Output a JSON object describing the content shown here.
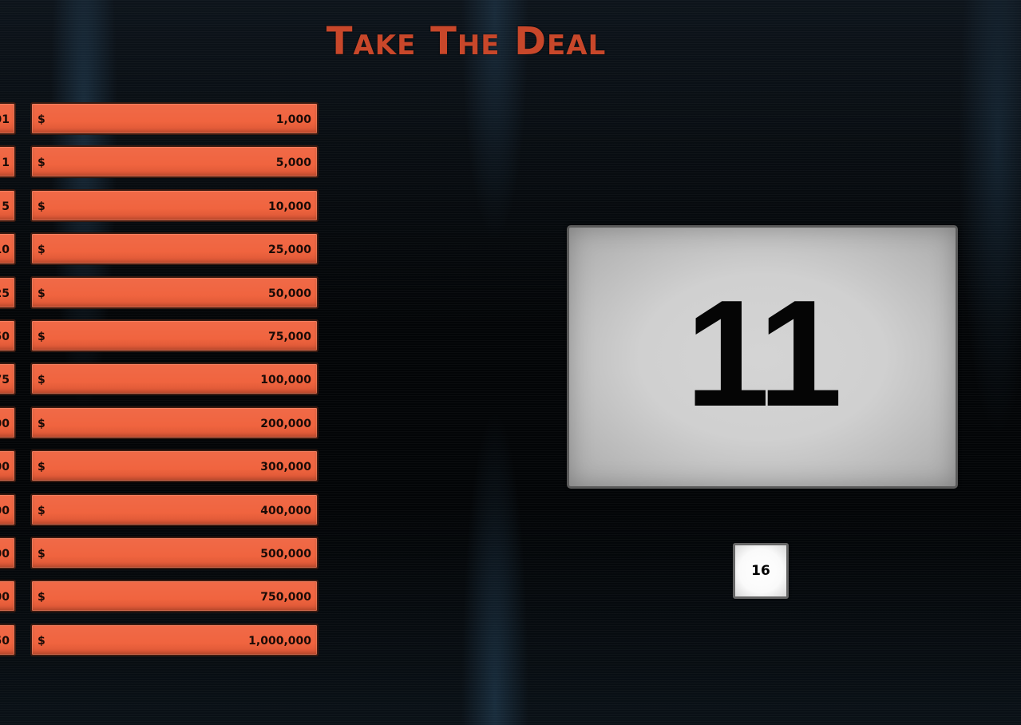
{
  "title": "Take The Deal",
  "currency_symbol": "$",
  "left_column_values": [
    "01",
    "1",
    "5",
    "10",
    "25",
    "50",
    "75",
    "00",
    "00",
    "00",
    "00",
    "00",
    "50"
  ],
  "right_column_values": [
    "1,000",
    "5,000",
    "10,000",
    "25,000",
    "50,000",
    "75,000",
    "100,000",
    "200,000",
    "300,000",
    "400,000",
    "500,000",
    "750,000",
    "1,000,000"
  ],
  "selected_case": "11",
  "remaining_case": "16",
  "colors": {
    "title": "#c8472a",
    "money_box": "#f0643f",
    "case_face": "#d0d0d0"
  }
}
